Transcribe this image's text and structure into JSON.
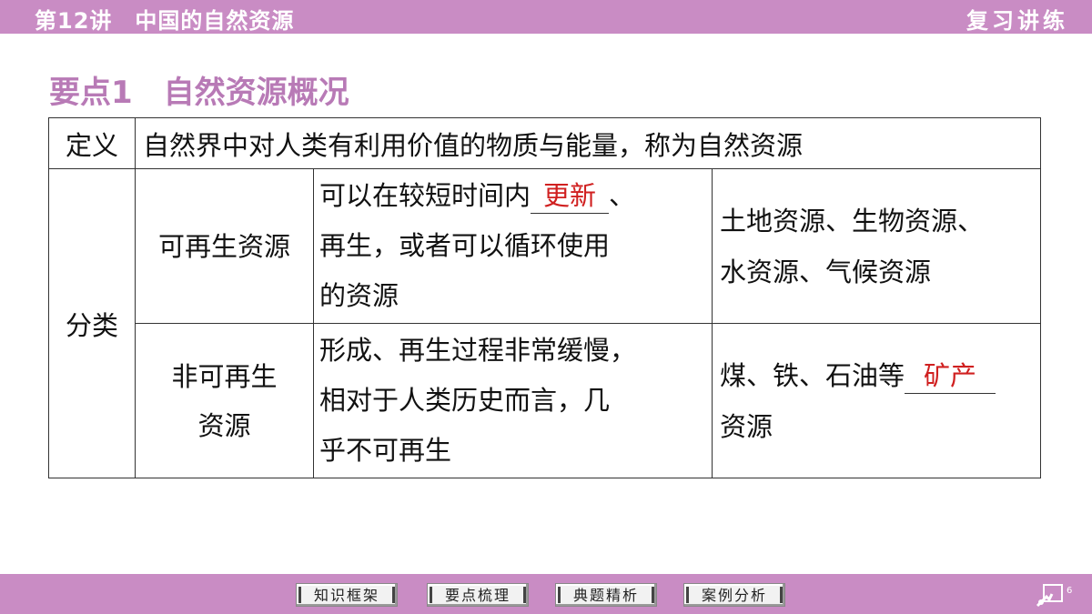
{
  "header": {
    "title": "第12讲　中国的自然资源",
    "right_label": "复习讲练"
  },
  "heading": "要点1　自然资源概况",
  "table": {
    "row_definition": {
      "label": "定义",
      "text": "自然界中对人类有利用价值的物质与能量，称为自然资源"
    },
    "category_label": "分类",
    "renewable": {
      "type": "可再生资源",
      "desc_before": "可以在较短时间内",
      "blank_answer": "更新",
      "desc_after_1": "、",
      "desc_after_2": "再生，或者可以循环使用",
      "desc_after_3": "的资源",
      "examples_1": "土地资源、生物资源、",
      "examples_2": "水资源、气候资源"
    },
    "nonrenewable": {
      "type_1": "非可再生",
      "type_2": "资源",
      "desc_1": "形成、再生过程非常缓慢，",
      "desc_2": "相对于人类历史而言，几",
      "desc_3": "乎不可再生",
      "examples_before": "煤、铁、石油等",
      "blank_answer": "矿产",
      "examples_after": "资源"
    }
  },
  "nav": {
    "items": [
      "知识框架",
      "要点梳理",
      "典题精析",
      "案例分析"
    ]
  },
  "page_number": "6",
  "colors": {
    "bar": "#c98cc4",
    "heading": "#b87ab6",
    "answer": "#d02020"
  },
  "icons": {
    "page": "page-pointer-icon"
  }
}
